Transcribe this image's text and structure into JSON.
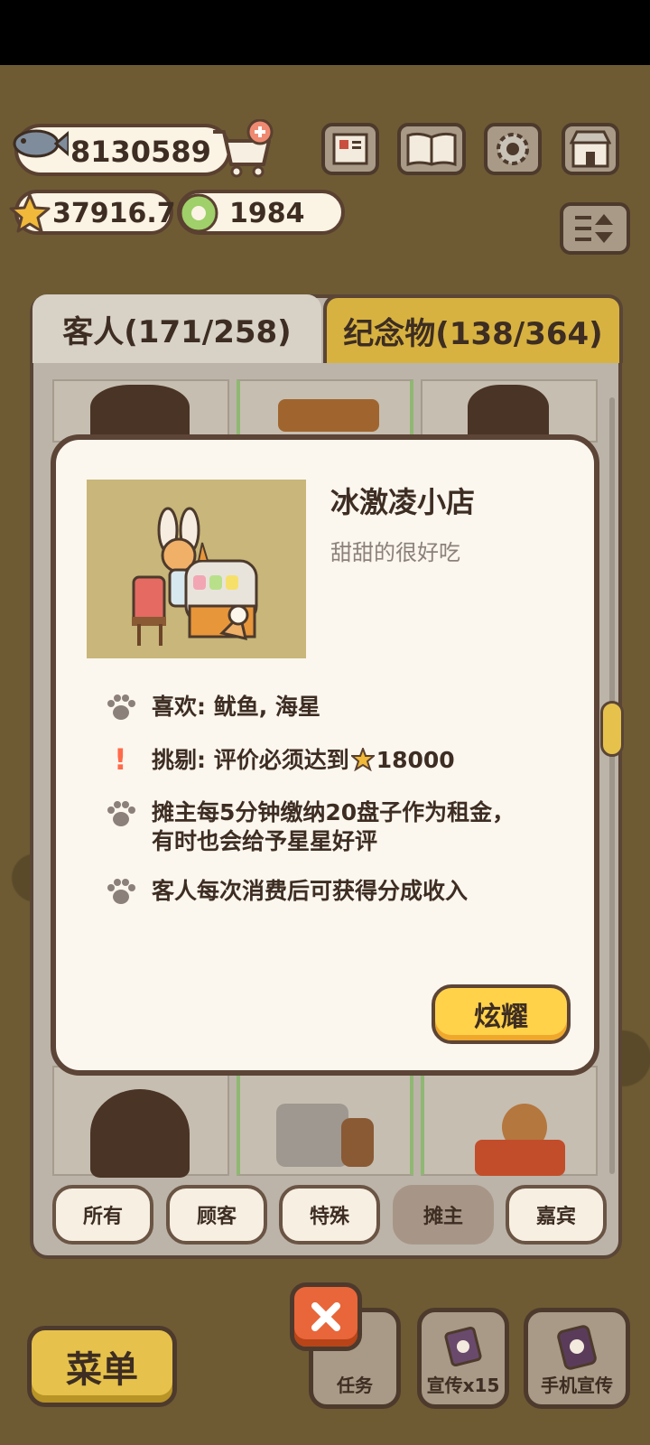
{
  "currency": {
    "fish": "8130589",
    "stars": "37916.7",
    "gems": "1984"
  },
  "tabs": {
    "guests": "客人(171/258)",
    "souvenirs": "纪念物(138/364)"
  },
  "detail": {
    "title": "冰激凌小店",
    "subtitle": "甜甜的很好吃",
    "likes": "喜欢: 鱿鱼, 海星",
    "picky_prefix": "挑剔: 评价必须达到",
    "picky_value": "18000",
    "rent_line1": "摊主每5分钟缴纳20盘子作为租金，",
    "rent_line2": "有时也会给予星星好评",
    "share": "客人每次消费后可获得分成收入",
    "show_button": "炫耀"
  },
  "filters": [
    "所有",
    "顾客",
    "特殊",
    "摊主",
    "嘉宾"
  ],
  "active_filter": "摊主",
  "bottom": {
    "menu": "菜单",
    "tasks": "任务",
    "promo": "宣传x15",
    "phone_promo": "手机宣传"
  }
}
